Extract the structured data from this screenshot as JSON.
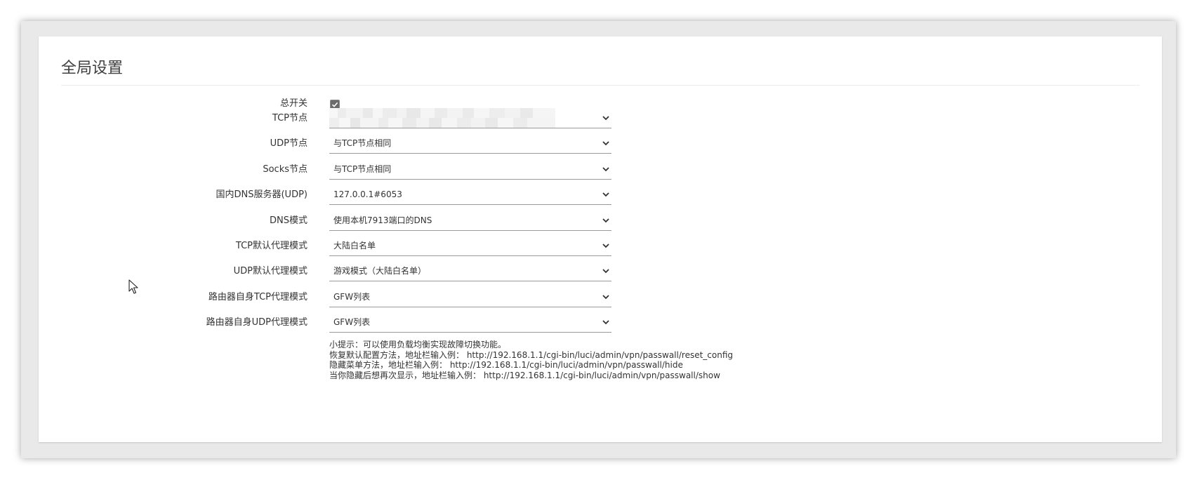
{
  "section": {
    "title": "全局设置"
  },
  "fields": {
    "main_switch": {
      "label": "总开关",
      "checked": true
    },
    "tcp_node": {
      "label": "TCP节点",
      "value": ""
    },
    "udp_node": {
      "label": "UDP节点",
      "value": "与TCP节点相同"
    },
    "socks_node": {
      "label": "Socks节点",
      "value": "与TCP节点相同"
    },
    "dns_server": {
      "label": "国内DNS服务器(UDP)",
      "value": "127.0.0.1#6053"
    },
    "dns_mode": {
      "label": "DNS模式",
      "value": "使用本机7913端口的DNS"
    },
    "tcp_proxy_mode": {
      "label": "TCP默认代理模式",
      "value": "大陆白名单"
    },
    "udp_proxy_mode": {
      "label": "UDP默认代理模式",
      "value": "游戏模式（大陆白名单）"
    },
    "router_tcp_proxy_mode": {
      "label": "路由器自身TCP代理模式",
      "value": "GFW列表"
    },
    "router_udp_proxy_mode": {
      "label": "路由器自身UDP代理模式",
      "value": "GFW列表"
    }
  },
  "tips": {
    "line1": "小提示：可以使用负载均衡实现故障切换功能。",
    "line2": "恢复默认配置方法，地址栏输入例：  http://192.168.1.1/cgi-bin/luci/admin/vpn/passwall/reset_config",
    "line3": "隐藏菜单方法，地址栏输入例：  http://192.168.1.1/cgi-bin/luci/admin/vpn/passwall/hide",
    "line4": "当你隐藏后想再次显示，地址栏输入例：  http://192.168.1.1/cgi-bin/luci/admin/vpn/passwall/show"
  },
  "colors": {
    "accent": "#6b6b6b",
    "underline": "#9a9a9a",
    "card": "#ffffff",
    "frame": "#e9e9e9"
  }
}
